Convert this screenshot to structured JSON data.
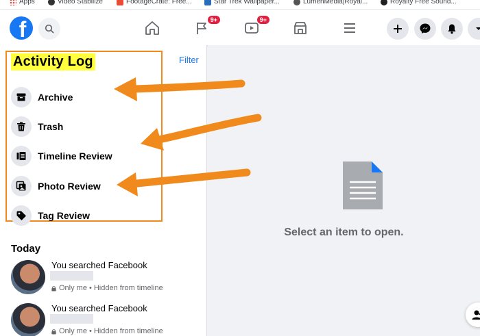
{
  "bookmarks": [
    {
      "label": "Apps",
      "color": "#4285f4"
    },
    {
      "label": "Video Stabilize",
      "color": "#333"
    },
    {
      "label": "FootageCrate: Free...",
      "color": "#e94b35"
    },
    {
      "label": "Star Trek Wallpaper...",
      "color": "#2a6ebb"
    },
    {
      "label": "LumenMedia|Royal...",
      "color": "#555"
    },
    {
      "label": "Royalty Free Sound...",
      "color": "#222"
    }
  ],
  "nav": {
    "logo": "f",
    "search_icon": "search-icon",
    "badges": {
      "flag": "9+",
      "watch": "9+"
    }
  },
  "activity_log": {
    "title": "Activity Log",
    "filter": "Filter",
    "items": [
      {
        "label": "Archive",
        "icon": "archive-icon"
      },
      {
        "label": "Trash",
        "icon": "trash-icon"
      },
      {
        "label": "Timeline Review",
        "icon": "timeline-review-icon"
      },
      {
        "label": "Photo Review",
        "icon": "photo-review-icon"
      },
      {
        "label": "Tag Review",
        "icon": "tag-icon"
      }
    ]
  },
  "today": {
    "heading": "Today",
    "entries": [
      {
        "text": "You searched Facebook",
        "privacy": "Only me",
        "visibility": "Hidden from timeline"
      },
      {
        "text": "You searched Facebook",
        "privacy": "Only me",
        "visibility": "Hidden from timeline"
      }
    ]
  },
  "empty_state": {
    "message": "Select an item to open."
  },
  "colors": {
    "brand": "#1877f2",
    "highlight": "#ffff3d",
    "annotation": "#f08a1c",
    "badge": "#e41e3f"
  }
}
